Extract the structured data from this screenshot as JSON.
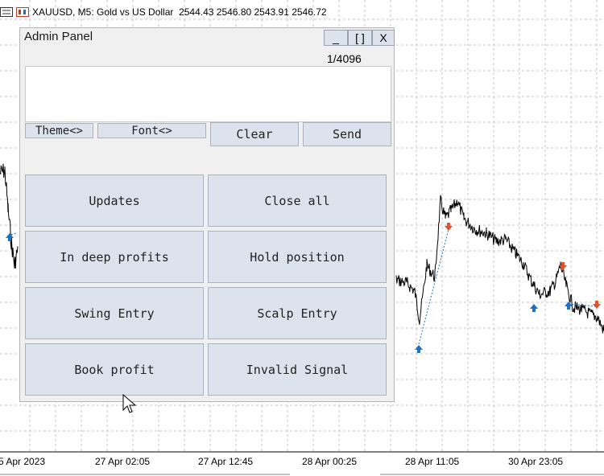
{
  "chart_header": {
    "symbol": "XAUUSD, M5:",
    "description": "Gold vs US Dollar",
    "prices": "2544.43 2546.80 2543.91 2546.72"
  },
  "x_axis_labels": [
    "5 Apr 2023",
    "27 Apr 02:05",
    "27 Apr 12:45",
    "28 Apr 00:25",
    "28 Apr 11:05",
    "30 Apr 23:05"
  ],
  "panel": {
    "title": "Admin Panel",
    "minimize_label": "_",
    "maximize_label": "[ ]",
    "close_label": "X",
    "char_counter": "1/4096",
    "message_value": "",
    "theme_label": "Theme<>",
    "font_label": "Font<>",
    "clear_label": "Clear",
    "send_label": "Send",
    "quick_messages": [
      "Updates",
      "Close all",
      "In deep profits",
      "Hold position",
      "Swing Entry",
      "Scalp Entry",
      "Book profit",
      "Invalid Signal"
    ]
  },
  "colors": {
    "button_bg": "#dde3ed",
    "panel_bg": "#f0f0f0",
    "buy_arrow": "#1f6fc5",
    "sell_arrow": "#e0522b"
  }
}
